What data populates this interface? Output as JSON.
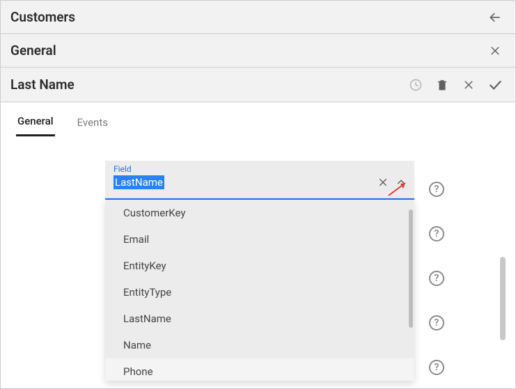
{
  "header": {
    "level1_title": "Customers",
    "level2_title": "General",
    "level3_title": "Last Name"
  },
  "tabs": {
    "items": [
      {
        "label": "General",
        "active": true
      },
      {
        "label": "Events",
        "active": false
      }
    ]
  },
  "field": {
    "label": "Field",
    "value": "LastName",
    "options": [
      "CustomerKey",
      "Email",
      "EntityKey",
      "EntityType",
      "LastName",
      "Name",
      "Phone"
    ]
  },
  "colors": {
    "accent": "#1a73e8",
    "selection": "#2a80f5",
    "annotation_arrow": "#e53935"
  }
}
